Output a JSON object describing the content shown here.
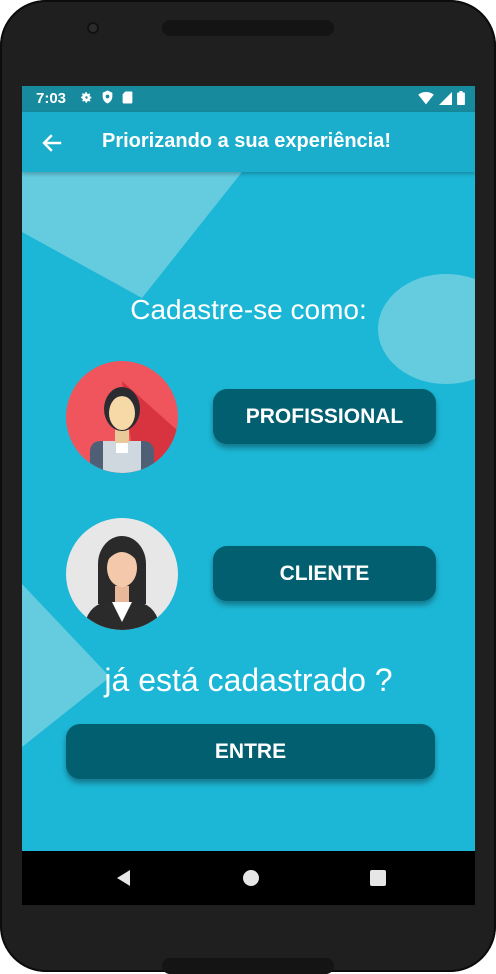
{
  "status_bar": {
    "time": "7:03",
    "left_icons": [
      "gear-icon",
      "shield-icon",
      "sd-card-icon"
    ],
    "right_icons": [
      "wifi-icon",
      "signal-icon",
      "battery-icon"
    ]
  },
  "app_bar": {
    "title": "Priorizando a sua experiência!",
    "back_icon": "arrow-left-icon"
  },
  "main": {
    "register_heading": "Cadastre-se como:",
    "options": [
      {
        "label": "PROFISSIONAL",
        "avatar": "worker-avatar-icon"
      },
      {
        "label": "CLIENTE",
        "avatar": "businesswoman-avatar-icon"
      }
    ],
    "already_heading": "já está cadastrado ?",
    "login_label": "ENTRE"
  },
  "nav_bar": {
    "icons": [
      "back-triangle-icon",
      "home-circle-icon",
      "recents-square-icon"
    ]
  },
  "colors": {
    "background": "#1cb7d6",
    "app_bar": "#1aaecc",
    "status_bar": "#178a9e",
    "button": "#025f6f",
    "text": "#ffffff"
  }
}
